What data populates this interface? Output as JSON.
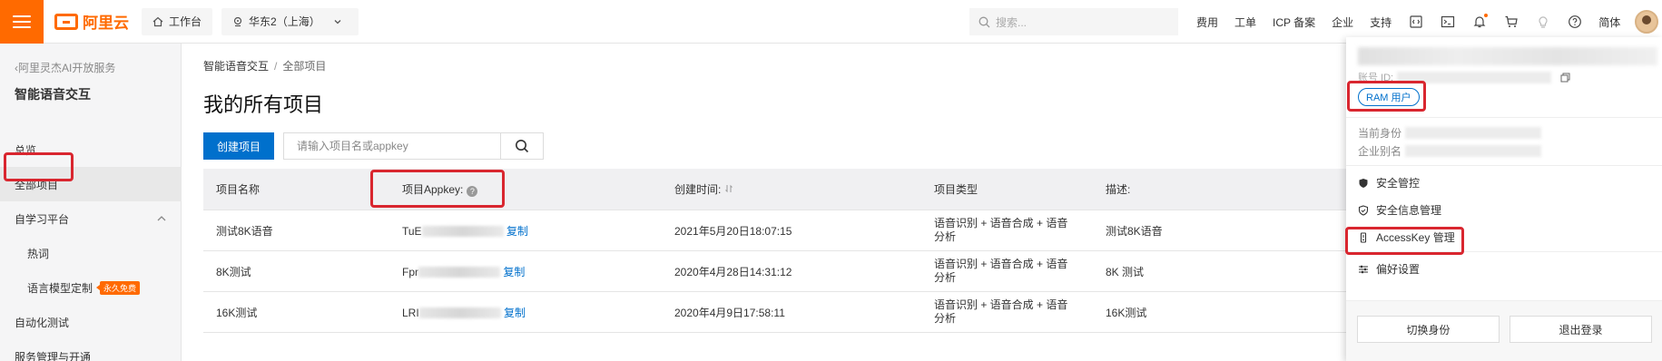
{
  "topbar": {
    "logo_text": "阿里云",
    "workbench_label": "工作台",
    "region_label": "华东2（上海）",
    "search_placeholder": "搜索...",
    "nav_items": [
      "费用",
      "工单",
      "ICP 备案",
      "企业",
      "支持"
    ],
    "lang_label": "简体",
    "icons": [
      "code-icon",
      "terminal-icon",
      "bell-icon",
      "cart-icon",
      "bulb-icon",
      "help-icon"
    ],
    "accent_color": "#ff6a00"
  },
  "sidebar": {
    "back_label": "阿里灵杰AI开放服务",
    "title": "智能语音交互",
    "items": [
      {
        "label": "总览",
        "active": false
      },
      {
        "label": "全部项目",
        "active": true
      },
      {
        "label": "自学习平台",
        "active": false,
        "expanded": true
      },
      {
        "label": "热词",
        "sub": true
      },
      {
        "label": "语言模型定制",
        "sub": true,
        "badge": "永久免费"
      },
      {
        "label": "自动化测试"
      },
      {
        "label": "服务管理与开通"
      }
    ]
  },
  "main": {
    "breadcrumb": [
      "智能语音交互",
      "全部项目"
    ],
    "title": "我的所有项目",
    "create_button": "创建项目",
    "search_placeholder": "请输入项目名或appkey",
    "table": {
      "headers": [
        "项目名称",
        "项目Appkey:",
        "创建时间:",
        "项目类型",
        "描述:"
      ],
      "copy_label": "复制",
      "rows": [
        {
          "name": "测试8K语音",
          "appkey_prefix": "TuE",
          "created": "2021年5月20日18:07:15",
          "type": "语音识别 + 语音合成 + 语音分析",
          "desc": "测试8K语音"
        },
        {
          "name": "8K测试",
          "appkey_prefix": "Fpr",
          "created": "2020年4月28日14:31:12",
          "type": "语音识别 + 语音合成 + 语音分析",
          "desc": "8K 测试"
        },
        {
          "name": "16K测试",
          "appkey_prefix": "LRI",
          "created": "2020年4月9日17:58:11",
          "type": "语音识别 + 语音合成 + 语音分析",
          "desc": "16K测试"
        }
      ]
    }
  },
  "account": {
    "id_label": "账号 ID:",
    "ram_tag": "RAM 用户",
    "identity_label": "当前身份",
    "alias_label": "企业别名",
    "menu": [
      "安全管控",
      "安全信息管理",
      "AccessKey 管理",
      "偏好设置"
    ],
    "switch_button": "切换身份",
    "logout_button": "退出登录"
  },
  "highlight_color": "#d9262f"
}
